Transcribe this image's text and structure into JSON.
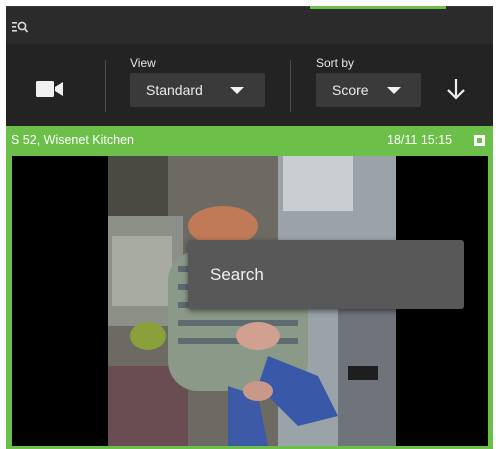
{
  "toolbar": {
    "view": {
      "label": "View",
      "value": "Standard"
    },
    "sort": {
      "label": "Sort by",
      "value": "Score"
    }
  },
  "card": {
    "title": "S 52, Wisenet Kitchen",
    "timestamp": "18/11 15:15",
    "selected": true
  },
  "context_menu": {
    "items": [
      {
        "label": "Search"
      }
    ]
  },
  "colors": {
    "accent": "#6cc04a",
    "panel": "#2b2b2b",
    "toolbar": "#232323",
    "menu": "#585858"
  },
  "icons": [
    "search-filter-icon",
    "camera-icon",
    "chevron-down-icon",
    "arrow-down-icon",
    "checkbox-icon"
  ]
}
